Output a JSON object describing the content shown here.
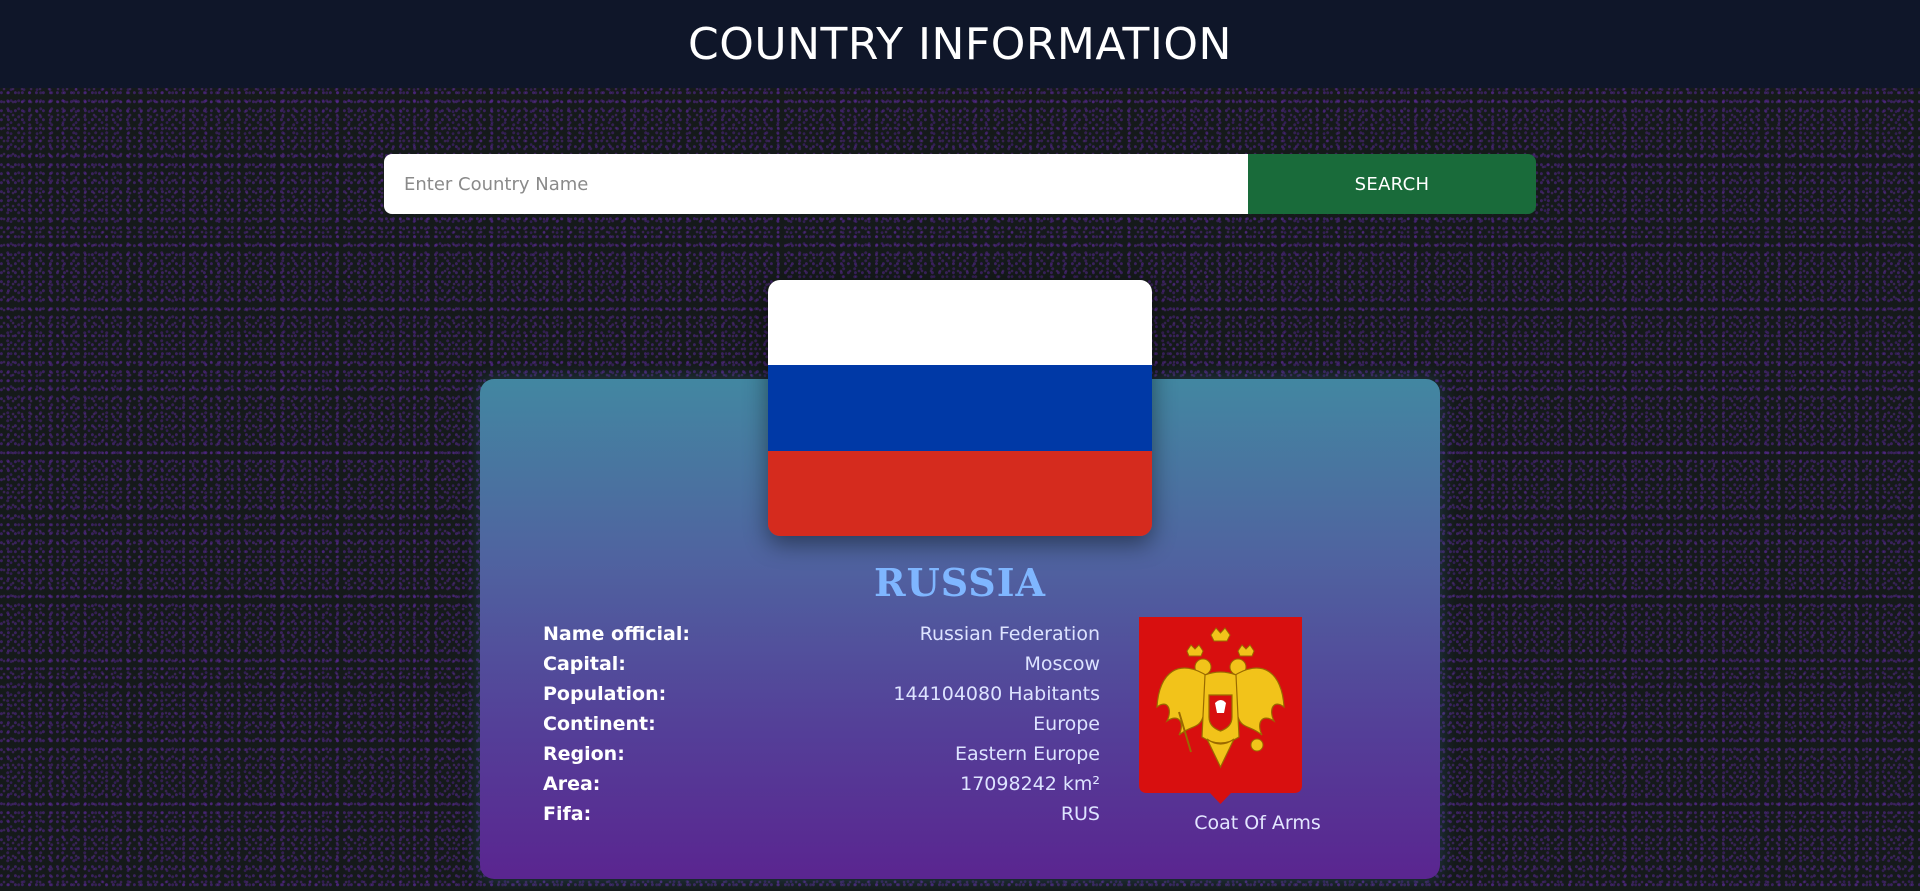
{
  "header": {
    "title": "COUNTRY INFORMATION"
  },
  "search": {
    "placeholder": "Enter Country Name",
    "value": "",
    "button_label": "SEARCH"
  },
  "country": {
    "name": "RUSSIA",
    "flag_colors": [
      "#ffffff",
      "#0039a6",
      "#d52b1e"
    ],
    "details": [
      {
        "label": "Name official:",
        "value": "Russian Federation"
      },
      {
        "label": "Capital:",
        "value": "Moscow"
      },
      {
        "label": "Population:",
        "value": "144104080 Habitants"
      },
      {
        "label": "Continent:",
        "value": "Europe"
      },
      {
        "label": "Region:",
        "value": "Eastern Europe"
      },
      {
        "label": "Area:",
        "value": "17098242 km²"
      },
      {
        "label": "Fifa:",
        "value": "RUS"
      }
    ],
    "coat_of_arms_caption": "Coat Of Arms"
  },
  "colors": {
    "header_bg": "#0f1629",
    "button_bg": "#196b3a",
    "country_name": "#7fb6ff"
  }
}
